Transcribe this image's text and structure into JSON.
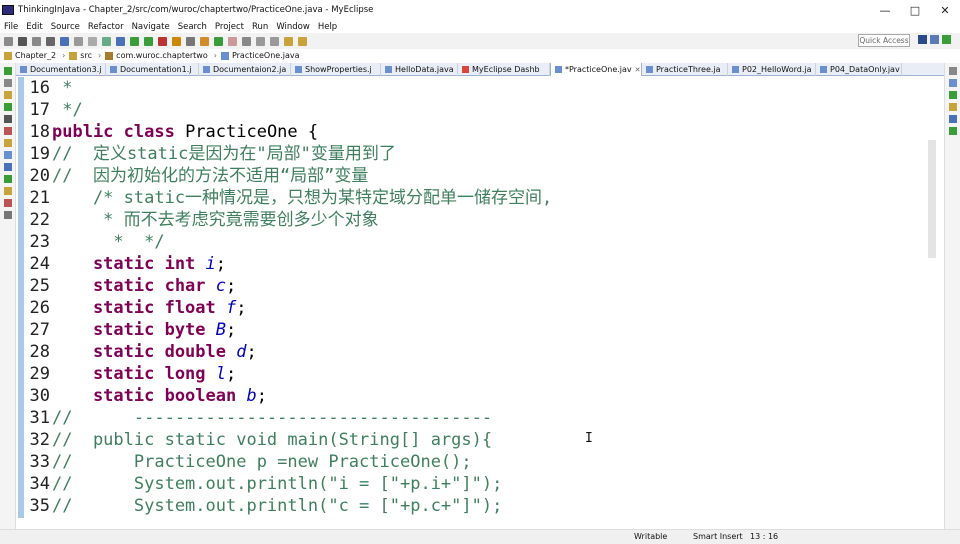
{
  "window": {
    "title": "ThinkingInJava - Chapter_2/src/com/wuroc/chaptertwo/PracticeOne.java - MyEclipse",
    "minimize": "—",
    "maximize": "□",
    "close": "✕"
  },
  "menu": [
    "File",
    "Edit",
    "Source",
    "Refactor",
    "Navigate",
    "Search",
    "Project",
    "Run",
    "Window",
    "Help"
  ],
  "quick_access": "Quick Access",
  "breadcrumb": [
    "Chapter_2",
    "src",
    "com.wuroc.chaptertwo",
    "PracticeOne.java"
  ],
  "tabs": [
    {
      "label": "Documentation3.j",
      "color": "#6a8fd1"
    },
    {
      "label": "Documentation1.j",
      "color": "#6a8fd1"
    },
    {
      "label": "Documentaion2.ja",
      "color": "#6a8fd1"
    },
    {
      "label": "ShowProperties.j",
      "color": "#6a8fd1"
    },
    {
      "label": "HelloData.java",
      "color": "#6a8fd1"
    },
    {
      "label": "MyEclipse Dashb",
      "color": "#d9463b"
    },
    {
      "label": "*PracticeOne.jav",
      "color": "#6a8fd1",
      "active": true,
      "close": "✕"
    },
    {
      "label": "PracticeThree.ja",
      "color": "#6a8fd1"
    },
    {
      "label": "P02_HelloWord.ja",
      "color": "#6a8fd1"
    },
    {
      "label": "P04_DataOnly.jav",
      "color": "#6a8fd1"
    }
  ],
  "code_lines": [
    {
      "n": "16",
      "segs": [
        {
          "t": " *",
          "c": "cm"
        }
      ]
    },
    {
      "n": "17",
      "segs": [
        {
          "t": " */",
          "c": "cm"
        }
      ]
    },
    {
      "n": "18",
      "segs": [
        {
          "t": "public class ",
          "c": "kw"
        },
        {
          "t": "PracticeOne {",
          "c": ""
        }
      ]
    },
    {
      "n": "19",
      "segs": [
        {
          "t": "//  定义static是因为在\"局部\"变量用到了",
          "c": "cm"
        }
      ]
    },
    {
      "n": "20",
      "segs": [
        {
          "t": "//  因为初始化的方法不适用“局部”变量",
          "c": "cm"
        }
      ]
    },
    {
      "n": "21",
      "segs": [
        {
          "t": "    /* static一种情况是，只想为某特定域分配单一储存空间,",
          "c": "cm"
        }
      ]
    },
    {
      "n": "22",
      "segs": [
        {
          "t": "     * 而不去考虑究竟需要创多少个对象",
          "c": "cm"
        }
      ]
    },
    {
      "n": "23",
      "segs": [
        {
          "t": "      *  */",
          "c": "cm"
        }
      ]
    },
    {
      "n": "24",
      "segs": [
        {
          "t": "    static int ",
          "c": "kw"
        },
        {
          "t": "i",
          "c": "it"
        },
        {
          "t": ";",
          "c": ""
        }
      ]
    },
    {
      "n": "25",
      "segs": [
        {
          "t": "    static char ",
          "c": "kw"
        },
        {
          "t": "c",
          "c": "it"
        },
        {
          "t": ";",
          "c": ""
        }
      ]
    },
    {
      "n": "26",
      "segs": [
        {
          "t": "    static float ",
          "c": "kw"
        },
        {
          "t": "f",
          "c": "it"
        },
        {
          "t": ";",
          "c": ""
        }
      ]
    },
    {
      "n": "27",
      "segs": [
        {
          "t": "    static byte ",
          "c": "kw"
        },
        {
          "t": "B",
          "c": "it"
        },
        {
          "t": ";",
          "c": ""
        }
      ]
    },
    {
      "n": "28",
      "segs": [
        {
          "t": "    static double ",
          "c": "kw"
        },
        {
          "t": "d",
          "c": "it"
        },
        {
          "t": ";",
          "c": ""
        }
      ]
    },
    {
      "n": "29",
      "segs": [
        {
          "t": "    static long ",
          "c": "kw"
        },
        {
          "t": "l",
          "c": "it"
        },
        {
          "t": ";",
          "c": ""
        }
      ]
    },
    {
      "n": "30",
      "segs": [
        {
          "t": "    static boolean ",
          "c": "kw"
        },
        {
          "t": "b",
          "c": "it"
        },
        {
          "t": ";",
          "c": ""
        }
      ]
    },
    {
      "n": "31",
      "segs": [
        {
          "t": "//      -----------------------------------",
          "c": "cm"
        }
      ]
    },
    {
      "n": "32",
      "segs": [
        {
          "t": "//  public static void main(String[] args){",
          "c": "cm"
        }
      ]
    },
    {
      "n": "33",
      "segs": [
        {
          "t": "//      PracticeOne p =new PracticeOne();",
          "c": "cm"
        }
      ]
    },
    {
      "n": "34",
      "segs": [
        {
          "t": "//      System.out.println(\"i = [\"+p.i+\"]\");",
          "c": "cm"
        }
      ]
    },
    {
      "n": "35",
      "segs": [
        {
          "t": "//      System.out.println(\"c = [\"+p.c+\"]\");",
          "c": "cm"
        }
      ]
    }
  ],
  "status": {
    "writable": "Writable",
    "insert_mode": "Smart Insert",
    "position": "13 : 16"
  },
  "cursor_glyph": "I",
  "colors": {
    "keyword": "#7f0055",
    "comment": "#3f7f5f",
    "field": "#0000c0",
    "gutter": "#a9c9e6"
  }
}
